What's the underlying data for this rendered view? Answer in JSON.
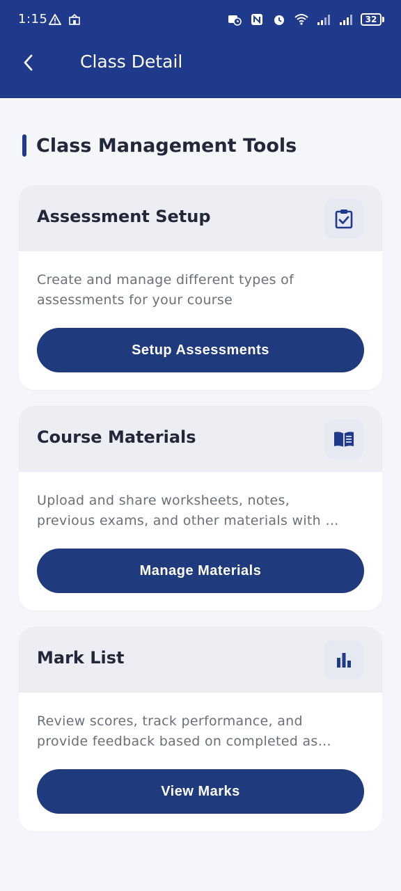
{
  "status_bar": {
    "time": "1:15",
    "battery": "32"
  },
  "header": {
    "title": "Class Detail"
  },
  "section": {
    "title": "Class Management Tools"
  },
  "cards": [
    {
      "title": "Assessment Setup",
      "icon": "assignment-check-icon",
      "desc_line1": "Create and manage different types of",
      "desc_line2": "assessments for your course",
      "button": "Setup Assessments"
    },
    {
      "title": "Course Materials",
      "icon": "book-open-icon",
      "desc_line1": "Upload and share worksheets, notes,",
      "desc_line2": "previous exams, and other materials with …",
      "button": "Manage Materials"
    },
    {
      "title": "Mark List",
      "icon": "bar-chart-icon",
      "desc_line1": "Review scores, track performance, and",
      "desc_line2": "provide feedback based on completed as…",
      "button": "View Marks"
    }
  ],
  "colors": {
    "primary": "#1f3a8a",
    "button": "#1f3a7d",
    "background": "#f5f6fa",
    "card_header": "#eceef4"
  }
}
